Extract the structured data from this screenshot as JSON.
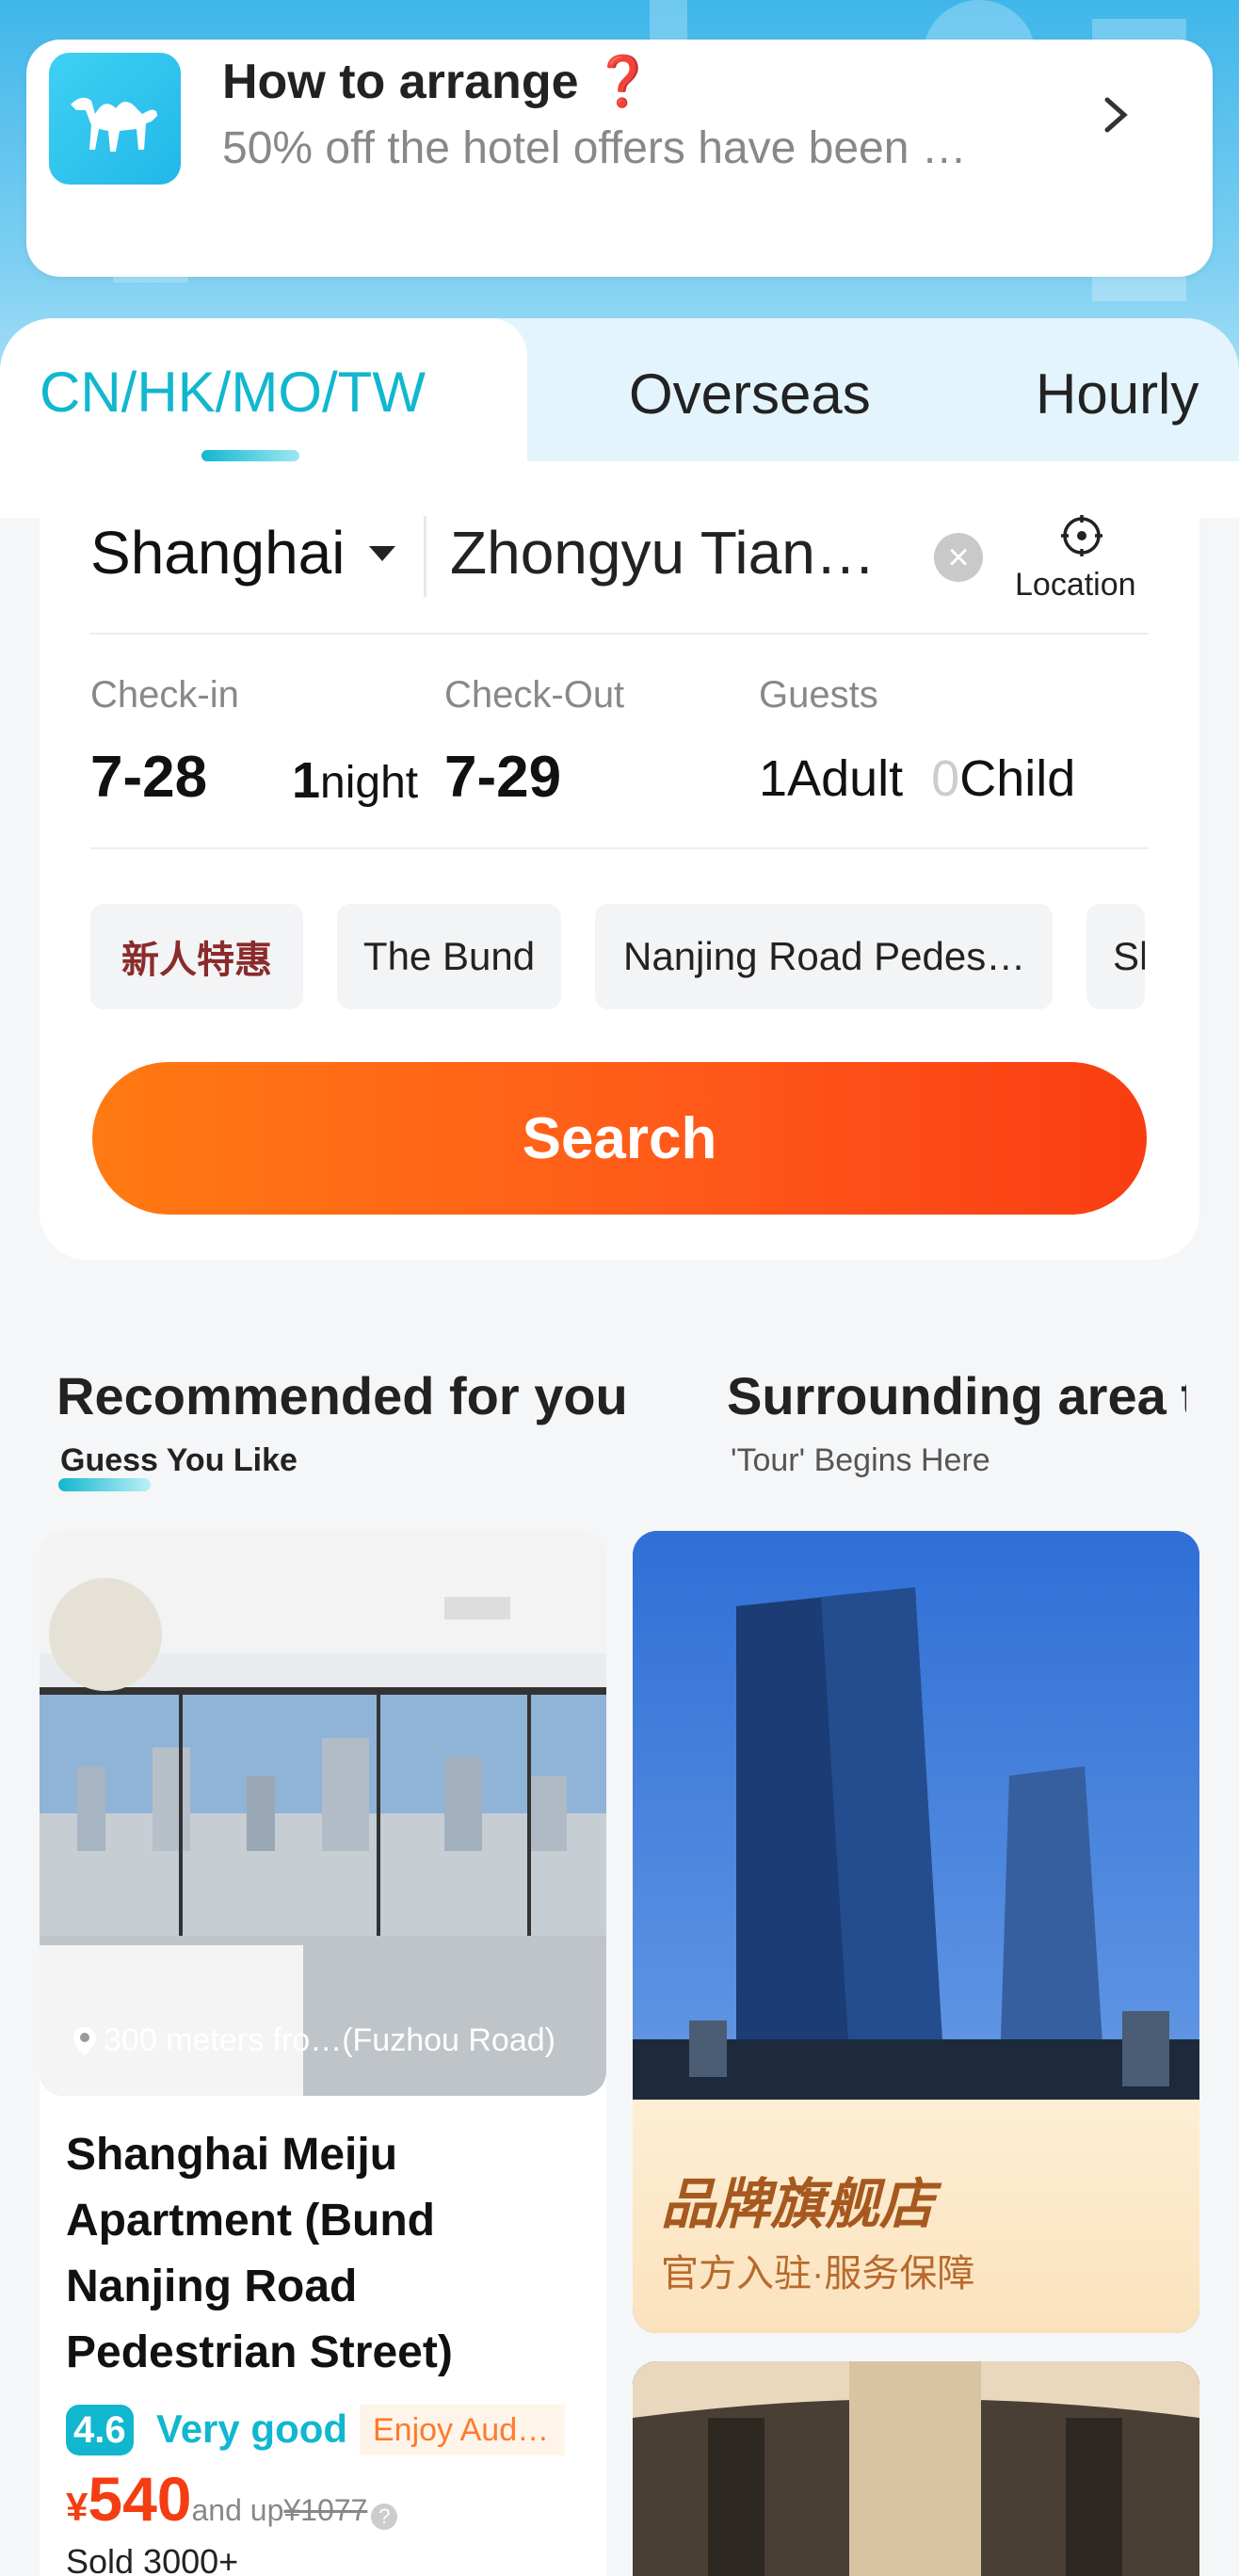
{
  "promo": {
    "title": "How to arrange",
    "title_mark": "❓",
    "subtitle": "50% off the hotel offers have been …",
    "icon": "camel-logo-icon"
  },
  "tabs": [
    {
      "label": "CN/HK/MO/TW",
      "active": true
    },
    {
      "label": "Overseas",
      "active": false
    },
    {
      "label": "Hourly",
      "active": false
    }
  ],
  "search": {
    "city": "Shanghai",
    "keyword": "Zhongyu Tian…",
    "location_label": "Location",
    "checkin_label": "Check-in",
    "checkout_label": "Check-Out",
    "guests_label": "Guests",
    "checkin_date": "7-28",
    "checkout_date": "7-29",
    "nights_count": "1",
    "nights_unit": "night",
    "adults_count": "1",
    "adults_unit": "Adult",
    "children_count": "0",
    "children_unit": "Child",
    "chips": [
      "新人特惠",
      "The Bund",
      "Nanjing Road Pedes…",
      "Sh"
    ],
    "button_label": "Search"
  },
  "sections": {
    "recommended_title": "Recommended for you",
    "recommended_sub": "Guess You Like",
    "surrounding_title": "Surrounding area t",
    "surrounding_sub": "'Tour' Begins Here"
  },
  "hotel": {
    "distance": "300 meters fro…(Fuzhou Road)",
    "name": "Shanghai Meiju Apartment (Bund Nanjing Road Pedestrian Street)",
    "score": "4.6",
    "score_text": "Very good",
    "perk": "Enjoy Aud…",
    "currency": "¥",
    "price": "540",
    "price_suffix": "and up",
    "original_price": "¥1077",
    "sold": "Sold 3000+"
  },
  "brand_tile": {
    "title": "品牌旗舰店",
    "subtitle": "官方入驻·服务保障"
  },
  "colors": {
    "accent": "#11b7cf",
    "search_button": "#ff5a1a",
    "price": "#f43d12"
  }
}
